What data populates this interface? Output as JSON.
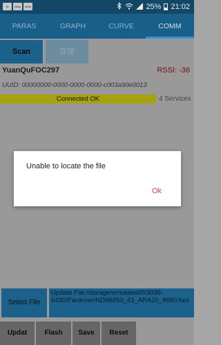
{
  "status_bar": {
    "notifications": [
      "ID",
      "eBay",
      "eBay"
    ],
    "battery": "25%",
    "time": "21:02"
  },
  "tabs": [
    {
      "label": "PARAS"
    },
    {
      "label": "GRAPH"
    },
    {
      "label": "CURVE"
    },
    {
      "label": "COMM",
      "active": true
    }
  ],
  "ble": {
    "scan_label": "Scan",
    "connect_label": "连接",
    "device_name": "YuanQuFOC297",
    "rssi": "RSSI: -36",
    "uuid": "UUID: 00000000-0000-0000-0000-c003a90e0013",
    "connection_status": "Connected OK",
    "services": "4 Services"
  },
  "update": {
    "select_file_label": "Select File",
    "file_path": "Update File:/storage/emulated/0/3036-6430/Fardriver/ND96850_43_ARA20_8680.hex"
  },
  "actions": {
    "update_label": "Updat",
    "flash_label": "Flash",
    "save_label": "Save",
    "reset_label": "Reset"
  },
  "dialog": {
    "message": "Unable to locate the file",
    "ok_label": "Ok"
  },
  "colors": {
    "status_bar_bg": "#154e71",
    "tab_bar_bg": "#1b6896",
    "tab_indicator": "#3aa0ee",
    "button_blue": "#1e6a98",
    "connected_bar": "#b3b010",
    "dialog_accent": "#d8337b"
  }
}
